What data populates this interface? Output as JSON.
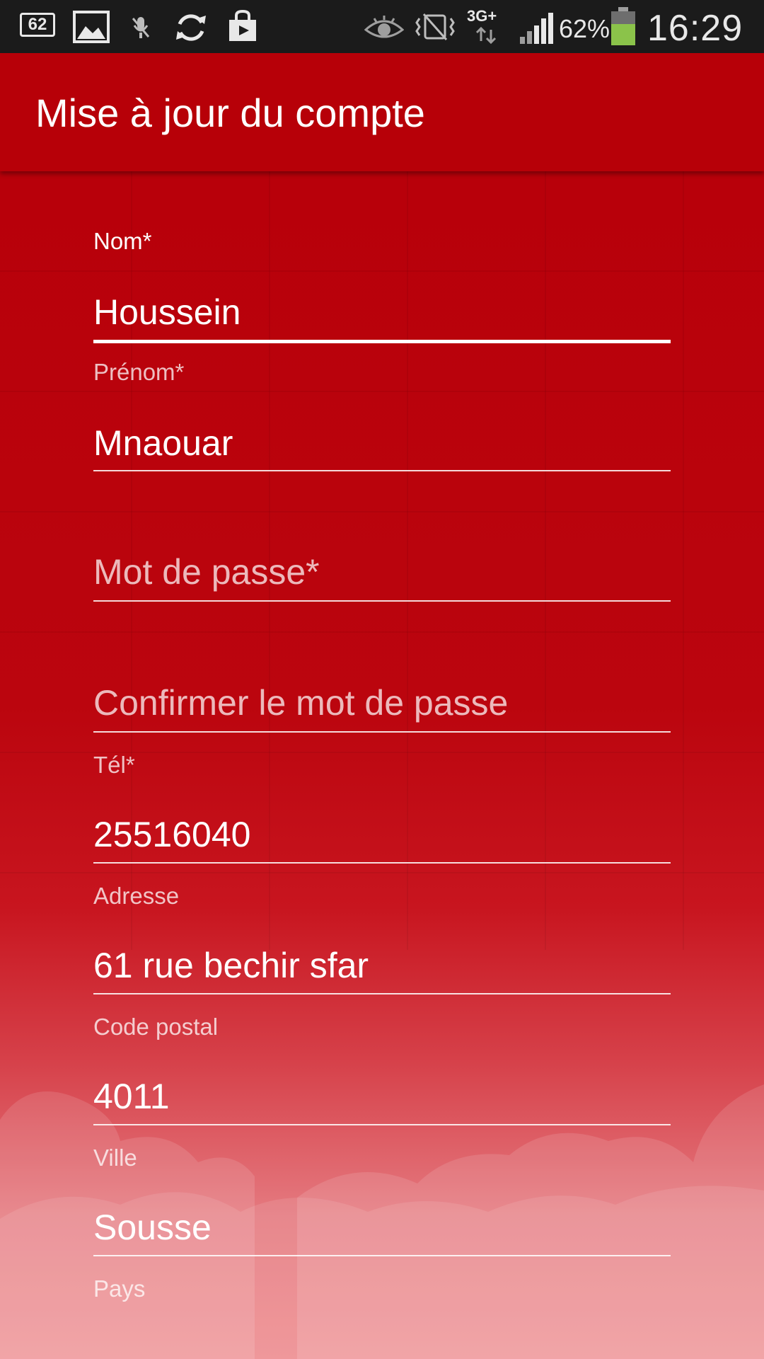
{
  "status_bar": {
    "notification_count": "62",
    "network": "3G+",
    "battery_percent": "62%",
    "time": "16:29",
    "icons": [
      "notification-count-icon",
      "gallery-icon",
      "mic-off-icon",
      "sync-icon",
      "store-bag-icon",
      "eye-icon",
      "nfc-vibrate-icon",
      "network-3g-icon",
      "signal-icon",
      "battery-icon"
    ],
    "battery_color": "#8bc34a"
  },
  "action_bar": {
    "title": "Mise à jour du compte",
    "color": "#b70008"
  },
  "form": {
    "nom": {
      "label": "Nom*",
      "value": "Houssein"
    },
    "prenom": {
      "label": "Prénom*",
      "value": "Mnaouar"
    },
    "mot_de_passe": {
      "placeholder": "Mot de passe*"
    },
    "confirmer": {
      "placeholder": "Confirmer le mot de passe"
    },
    "tel": {
      "label": "Tél*",
      "value": "25516040"
    },
    "adresse": {
      "label": "Adresse",
      "value": "61 rue bechir sfar"
    },
    "code_postal": {
      "label": "Code postal",
      "value": "4011"
    },
    "ville": {
      "label": "Ville",
      "value": "Sousse"
    },
    "pays": {
      "label": "Pays"
    }
  }
}
